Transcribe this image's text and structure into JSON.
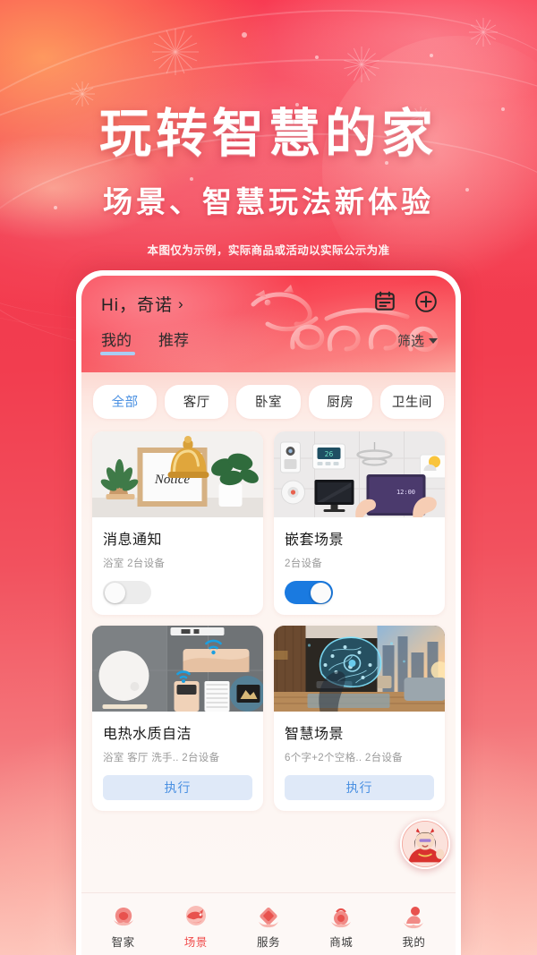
{
  "poster": {
    "headline": "玩转智慧的家",
    "subhead": "场景、智慧玩法新体验",
    "disclaimer": "本图仅为示例，实际商品或活动以实际公示为准",
    "brand_red": "#f43a4e",
    "accent_blue": "#4a90e2"
  },
  "app": {
    "header": {
      "greeting": "Hi，奇诺",
      "greeting_chevron": "›",
      "icons": [
        {
          "name": "log-icon",
          "label": "日志"
        },
        {
          "name": "add-circle-icon",
          "label": "添加"
        }
      ],
      "decor": "dragon-2024-graphic",
      "tabs": [
        {
          "label": "我的",
          "active": true
        },
        {
          "label": "推荐",
          "active": false
        }
      ],
      "filter_label": "筛选"
    },
    "room_chips": [
      {
        "label": "全部",
        "active": true
      },
      {
        "label": "客厅",
        "active": false
      },
      {
        "label": "卧室",
        "active": false
      },
      {
        "label": "厨房",
        "active": false
      },
      {
        "label": "卫生间",
        "active": false
      }
    ],
    "scene_cards": [
      {
        "title": "消息通知",
        "subtitle": "浴室  2台设备",
        "control": "toggle",
        "toggle_on": false,
        "image": "notice-board-with-bell-and-plants"
      },
      {
        "title": "嵌套场景",
        "subtitle": "2台设备",
        "control": "toggle",
        "toggle_on": true,
        "image": "smart-home-device-wall-with-tablet"
      },
      {
        "title": "电热水质自洁",
        "subtitle": "浴室 客厅 洗手..  2台设备",
        "control": "button",
        "button_label": "执行",
        "image": "bathroom-water-heater-with-wifi"
      },
      {
        "title": "智慧场景",
        "subtitle": "6个字+2个空格..  2台设备",
        "control": "button",
        "button_label": "执行",
        "image": "ai-brain-over-living-room"
      }
    ],
    "bottom_nav": [
      {
        "label": "智家",
        "active": false
      },
      {
        "label": "场景",
        "active": true
      },
      {
        "label": "服务",
        "active": false
      },
      {
        "label": "商城",
        "active": false
      },
      {
        "label": "我的",
        "active": false
      }
    ],
    "floating_avatar": "girl-in-red-chinese-dress"
  }
}
